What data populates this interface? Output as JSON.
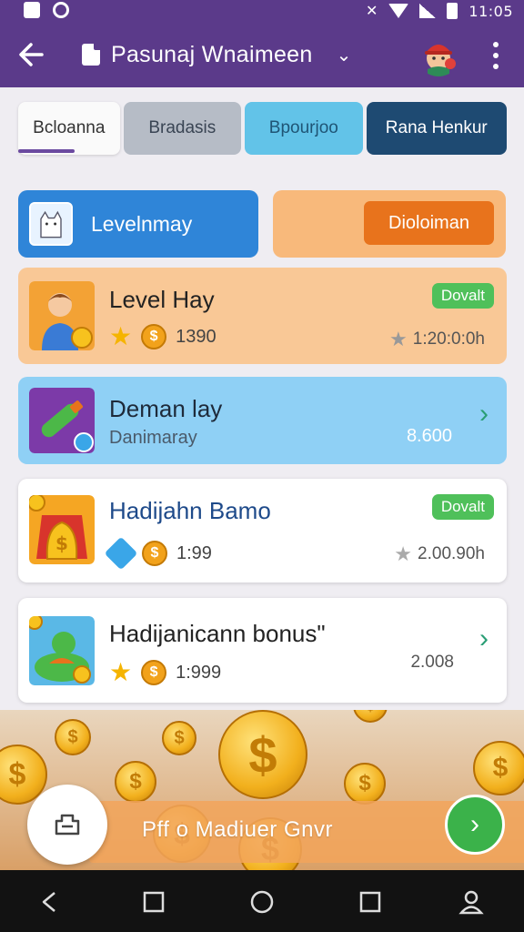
{
  "status": {
    "time": "11:05",
    "icons": [
      "gallery-icon",
      "sync-icon",
      "mute-icon",
      "wifi-icon",
      "signal-icon",
      "battery-icon"
    ]
  },
  "appbar": {
    "title": "Pasunaj Wnaimeen",
    "colors": {
      "bar": "#5b3a8a"
    }
  },
  "tabs": [
    {
      "label": "Bcloanna"
    },
    {
      "label": "Bradasis"
    },
    {
      "label": "Bpourjoo"
    },
    {
      "label": "Rana Henkur"
    }
  ],
  "actions": {
    "left_label": "Levelnmay",
    "right_button": "Dioloiman"
  },
  "cards": [
    {
      "title": "Level Hay",
      "points": "1390",
      "value": "1:20:0:0h",
      "badge": "Dovalt"
    },
    {
      "title": "Deman lay",
      "subtitle": "Danimaray",
      "value": "8.600"
    },
    {
      "title": "Hadijahn Bamo",
      "points": "1:99",
      "value": "2.00.90h",
      "badge": "Dovalt"
    },
    {
      "title": "Hadijanicann bonus\"",
      "points": "1:999",
      "value": "2.008"
    }
  ],
  "bottom": {
    "text": "Pff   o   Madiuer Gnvr"
  },
  "colors": {
    "accent": "#5b3a8a",
    "blue": "#2f85d8",
    "orange": "#e8731c",
    "green": "#4fc05a"
  }
}
